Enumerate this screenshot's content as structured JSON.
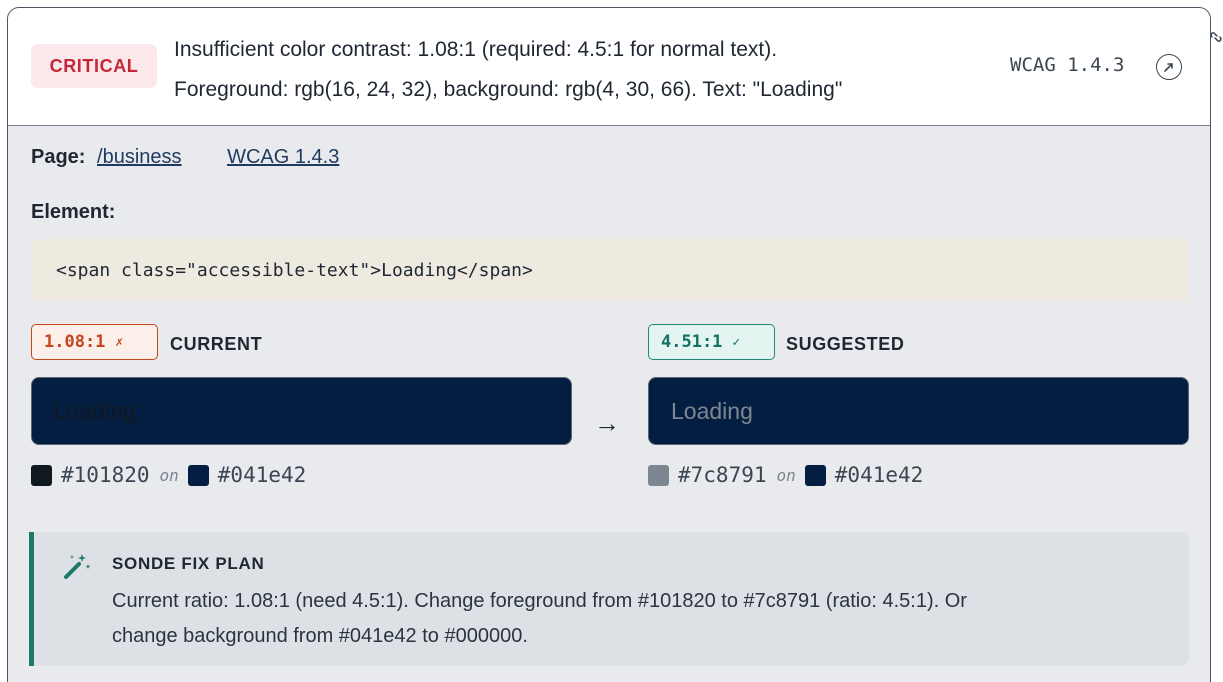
{
  "header": {
    "severity": "CRITICAL",
    "issue_line1": "Insufficient color contrast: 1.08:1 (required: 4.5:1 for normal text).",
    "issue_line2": "Foreground: rgb(16, 24, 32), background: rgb(4, 30, 66). Text: \"Loading\"",
    "wcag_ref": "WCAG 1.4.3",
    "action_icon": "external-link-icon",
    "corner_icon": "link-icon"
  },
  "meta": {
    "page_label": "Page:",
    "page_link": "/business",
    "wcag_link": "WCAG 1.4.3"
  },
  "element": {
    "label": "Element:",
    "code": "<span class=\"accessible-text\">Loading</span>"
  },
  "current": {
    "ratio": "1.08:1",
    "ratio_mark": "✗",
    "label": "CURRENT",
    "preview_text": "Loading",
    "fg": "#101820",
    "on_word": "on",
    "bg": "#041e42"
  },
  "arrow": "→",
  "suggested": {
    "ratio": "4.51:1",
    "ratio_mark": "✓",
    "label": "SUGGESTED",
    "preview_text": "Loading",
    "fg": "#7c8791",
    "on_word": "on",
    "bg": "#041e42"
  },
  "fix_plan": {
    "icon": "magic-wand-icon",
    "title": "SONDE FIX PLAN",
    "line1": "Current ratio: 1.08:1 (need 4.5:1). Change foreground from #101820 to #7c8791 (ratio: 4.5:1). Or",
    "line2": "change background from #041e42 to #000000."
  },
  "colors": {
    "critical": "#c2273a",
    "bad": "#c4461f",
    "good": "#137063",
    "accent": "#1a7a6a"
  }
}
